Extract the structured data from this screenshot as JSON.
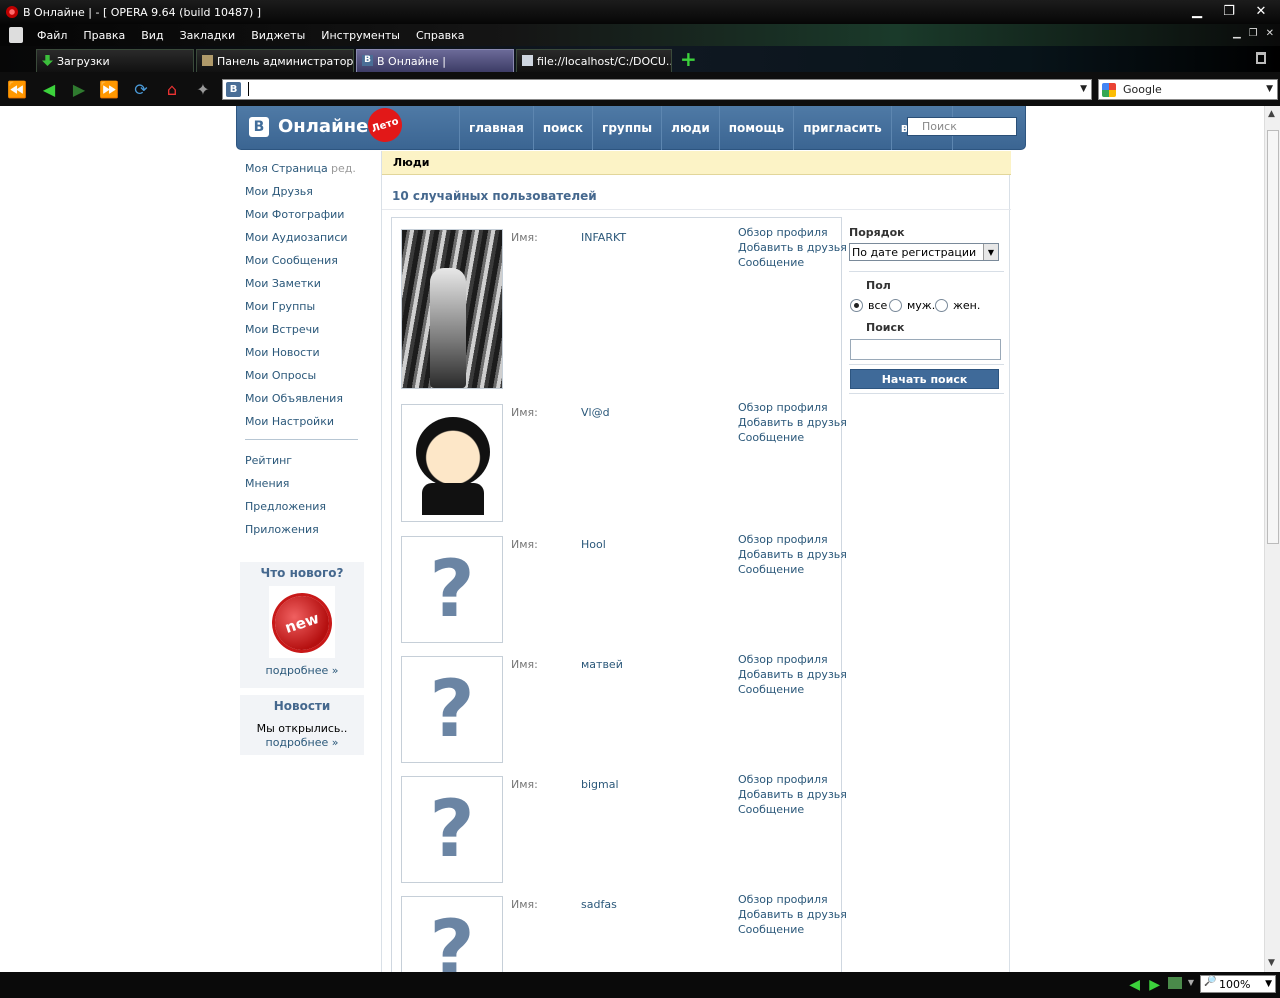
{
  "window": {
    "title": "В Онлайне | - [ OPERA 9.64 (build 10487) ]",
    "controls": {
      "minimize": "▁",
      "restore": "❐",
      "close": "✕"
    }
  },
  "menubar": {
    "items": [
      "Файл",
      "Правка",
      "Вид",
      "Закладки",
      "Виджеты",
      "Инструменты",
      "Справка"
    ]
  },
  "tabs": [
    {
      "label": "Загрузки",
      "icon": "download-icon"
    },
    {
      "label": "Панель администратора",
      "icon": "admin-icon"
    },
    {
      "label": "В Онлайне |",
      "icon": "vk-icon",
      "active": true
    },
    {
      "label": "file://localhost/C:/DOCU...",
      "icon": "file-icon"
    }
  ],
  "address_bar": {
    "value": "",
    "favicon": "В"
  },
  "search_engine": {
    "label": "Google"
  },
  "statusbar": {
    "zoom": "100%"
  },
  "site": {
    "logo": {
      "badge": "В",
      "text": "Онлайне",
      "leto": "Лето"
    },
    "nav": [
      "главная",
      "поиск",
      "группы",
      "люди",
      "помощь",
      "пригласить",
      "выйти"
    ],
    "search_placeholder": "Поиск"
  },
  "left_menu": {
    "edit_label": "ред.",
    "items": [
      "Моя Страница",
      "Мои Друзья",
      "Мои Фотографии",
      "Мои Аудиозаписи",
      "Мои Сообщения",
      "Мои Заметки",
      "Мои Группы",
      "Мои Встречи",
      "Мои Новости",
      "Мои Опросы",
      "Мои Объявления",
      "Мои Настройки"
    ],
    "extra_items": [
      "Рейтинг",
      "Мнения",
      "Предложения",
      "Приложения"
    ]
  },
  "promo_new": {
    "title": "Что нового?",
    "badge": "new",
    "more": "подробнее »"
  },
  "promo_news": {
    "title": "Новости",
    "text": "Мы открылись..",
    "more": "подробнее »"
  },
  "content": {
    "header": "Люди",
    "subtitle": "10 случайных пользователей"
  },
  "users": [
    {
      "name_label": "Имя:",
      "name": "INFARKT",
      "avatar": "photo"
    },
    {
      "name_label": "Имя:",
      "name": "Vl@d",
      "avatar": "toon"
    },
    {
      "name_label": "Имя:",
      "name": "Hool",
      "avatar": "question"
    },
    {
      "name_label": "Имя:",
      "name": "матвей",
      "avatar": "question"
    },
    {
      "name_label": "Имя:",
      "name": "bigmal",
      "avatar": "question"
    },
    {
      "name_label": "Имя:",
      "name": "sadfas",
      "avatar": "question"
    }
  ],
  "user_actions": {
    "profile": "Обзор профиля",
    "add_friend": "Добавить в друзья",
    "message": "Сообщение"
  },
  "placeholder_glyph": "?",
  "filters": {
    "order_label": "Порядок",
    "order_value": "По дате регистрации",
    "sex_label": "Пол",
    "sex_options": [
      "все",
      "муж.",
      "жен."
    ],
    "sex_selected": "все",
    "search_label": "Поиск",
    "search_button": "Начать поиск"
  }
}
